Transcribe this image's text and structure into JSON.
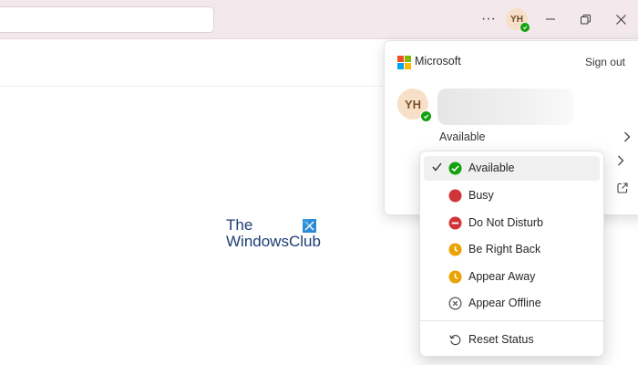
{
  "titlebar": {
    "more_label": "···",
    "avatar_initials": "YH",
    "status_color": "#13a10e"
  },
  "watermark": {
    "line1": "The",
    "line2": "WindowsClub"
  },
  "account": {
    "brand": "Microsoft",
    "sign_out": "Sign out",
    "initials": "YH",
    "current_status": "Available"
  },
  "status_menu": {
    "items": [
      {
        "label": "Available",
        "icon": "available-icon",
        "color": "#13a10e",
        "selected": true
      },
      {
        "label": "Busy",
        "icon": "busy-icon",
        "color": "#d13438"
      },
      {
        "label": "Do Not Disturb",
        "icon": "do-not-disturb-icon",
        "color": "#d13438"
      },
      {
        "label": "Be Right Back",
        "icon": "be-right-back-icon",
        "color": "#eaa300"
      },
      {
        "label": "Appear Away",
        "icon": "appear-away-icon",
        "color": "#eaa300"
      },
      {
        "label": "Appear Offline",
        "icon": "appear-offline-icon",
        "color": "#616161"
      }
    ],
    "reset_label": "Reset Status"
  }
}
